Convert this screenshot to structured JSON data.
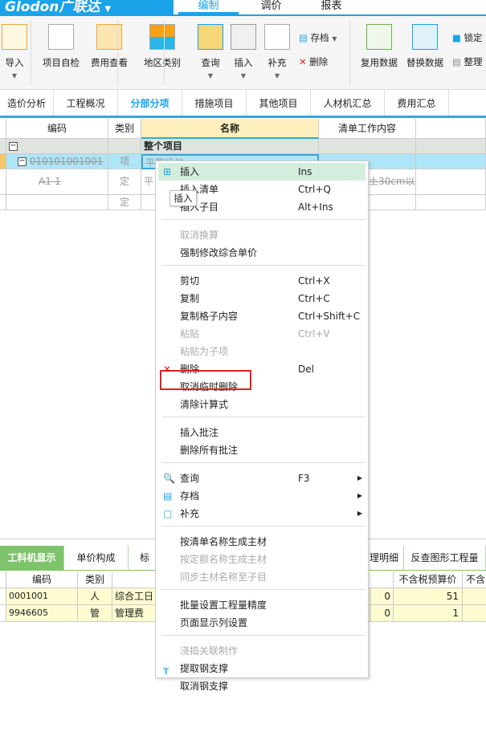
{
  "app": {
    "logo": "Glodon广联达",
    "menu_tabs": [
      "编制",
      "调价",
      "报表"
    ]
  },
  "ribbon": {
    "import": "导入",
    "self_check": "项目自检",
    "fee_view": "费用查看",
    "region": "地区类别",
    "query": "查询",
    "insert": "插入",
    "supplement": "补充",
    "archive": "存档",
    "delete": "删除",
    "reuse": "复用数据",
    "replace": "替换数据",
    "lock": "锁定",
    "organize": "整理"
  },
  "tabs": [
    "造价分析",
    "工程概况",
    "分部分项",
    "措施项目",
    "其他项目",
    "人材机汇总",
    "费用汇总"
  ],
  "grid": {
    "headers": [
      "编码",
      "类别",
      "名称",
      "清单工作内容"
    ],
    "rows": [
      {
        "code": "",
        "type": "",
        "name": "整个项目",
        "content": ""
      },
      {
        "code": "010101001001",
        "type": "项",
        "name": "平整场地",
        "content": ""
      },
      {
        "code": "A1-1",
        "type": "定",
        "name": "平",
        "content": "土30cm以"
      },
      {
        "code": "",
        "type": "定",
        "name": "",
        "content": ""
      }
    ]
  },
  "tooltip": "插入",
  "context_menu": [
    {
      "label": "插入",
      "shortcut": "Ins",
      "icon": "insert-icon",
      "highlighted": true
    },
    {
      "label": "插入清单",
      "shortcut": "Ctrl+Q"
    },
    {
      "label": "插入子目",
      "shortcut": "Alt+Ins"
    },
    {
      "sep": true
    },
    {
      "label": "取消换算",
      "disabled": true
    },
    {
      "label": "强制修改综合单价"
    },
    {
      "sep": true
    },
    {
      "label": "剪切",
      "shortcut": "Ctrl+X"
    },
    {
      "label": "复制",
      "shortcut": "Ctrl+C"
    },
    {
      "label": "复制格子内容",
      "shortcut": "Ctrl+Shift+C"
    },
    {
      "label": "粘贴",
      "shortcut": "Ctrl+V",
      "disabled": true
    },
    {
      "label": "粘贴为子项",
      "disabled": true
    },
    {
      "label": "删除",
      "shortcut": "Del",
      "icon": "delete-x-icon"
    },
    {
      "label": "取消临时删除",
      "boxed": true
    },
    {
      "label": "清除计算式"
    },
    {
      "sep": true
    },
    {
      "label": "插入批注"
    },
    {
      "label": "删除所有批注"
    },
    {
      "sep": true
    },
    {
      "label": "查询",
      "shortcut": "F3",
      "icon": "query-icon",
      "submenu": true
    },
    {
      "label": "存档",
      "icon": "archive-icon",
      "submenu": true
    },
    {
      "label": "补充",
      "icon": "supplement-icon",
      "submenu": true
    },
    {
      "sep": true
    },
    {
      "label": "按清单名称生成主材"
    },
    {
      "label": "按定额名称生成主材",
      "disabled": true
    },
    {
      "label": "同步主材名称至子目",
      "disabled": true
    },
    {
      "sep": true
    },
    {
      "label": "批量设置工程量精度"
    },
    {
      "label": "页面显示列设置"
    },
    {
      "sep": true
    },
    {
      "label": "浇捣关联制作",
      "disabled": true
    },
    {
      "label": "提取钢支撑",
      "icon": "steel-support-icon"
    },
    {
      "label": "取消钢支撑"
    }
  ],
  "bottom": {
    "tabs": [
      "工料机显示",
      "单价构成",
      "标",
      "理明细",
      "反查图形工程量"
    ],
    "headers": [
      "编码",
      "类别",
      "不含税预算价",
      "不含"
    ],
    "rows": [
      {
        "code": "0001001",
        "type": "人",
        "name": "综合工日",
        "v1": "0",
        "price": "51"
      },
      {
        "code": "9946605",
        "type": "管",
        "name": "管理费",
        "v1": "0",
        "price": "1"
      }
    ]
  },
  "colors": {
    "accent": "#1aa3e8",
    "green_tab": "#7ec46a",
    "highlight": "#d4eedd",
    "red_box": "#e02020"
  }
}
